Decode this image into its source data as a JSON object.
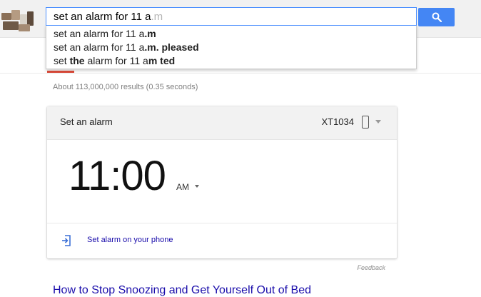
{
  "search": {
    "typed": "set an alarm for 11 a",
    "completion": ".m"
  },
  "suggestions": [
    {
      "parts": [
        {
          "text": "set an alarm for 11 a",
          "bold": false
        },
        {
          "text": ".m",
          "bold": true
        }
      ]
    },
    {
      "parts": [
        {
          "text": "set an alarm for 11 a",
          "bold": false
        },
        {
          "text": ".m. pleased",
          "bold": true
        }
      ]
    },
    {
      "parts": [
        {
          "text": "set ",
          "bold": false
        },
        {
          "text": "the",
          "bold": true
        },
        {
          "text": " alarm for 11 a",
          "bold": false
        },
        {
          "text": "m ted",
          "bold": true
        }
      ]
    }
  ],
  "results": {
    "stats": "About 113,000,000 results (0.35 seconds)"
  },
  "alarm_card": {
    "title": "Set an alarm",
    "device": "XT1034",
    "time": "11:00",
    "period": "AM",
    "set_on_phone": "Set alarm on your phone"
  },
  "feedback_label": "Feedback",
  "first_result": {
    "title": "How to Stop Snoozing and Get Yourself Out of Bed"
  },
  "colors": {
    "search_button": "#4486f4",
    "link": "#1a0dab",
    "tab_accent": "#dd4b39"
  },
  "icons": [
    "search-icon",
    "phone-icon",
    "chevron-down-icon",
    "open-phone-icon"
  ]
}
